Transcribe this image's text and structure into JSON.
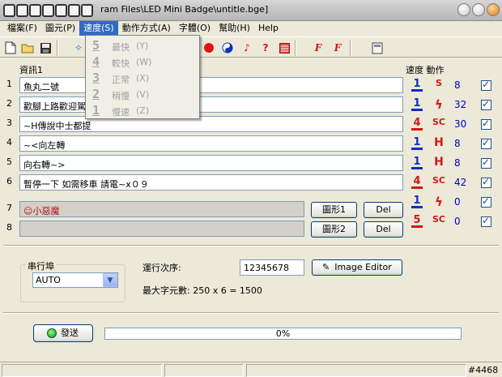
{
  "window": {
    "title_path": "ram Files\\LED Mini Badge\\untitle.bge]"
  },
  "menu": [
    {
      "label": "檔案(F)"
    },
    {
      "label": "圖元(P)"
    },
    {
      "label": "速度(S)"
    },
    {
      "label": "動作方式(A)"
    },
    {
      "label": "字體(O)"
    },
    {
      "label": "幫助(H)"
    },
    {
      "label": "Help"
    }
  ],
  "speed_menu": [
    {
      "icon": "5",
      "label": "最快",
      "key": "(Y)"
    },
    {
      "icon": "4",
      "label": "較快",
      "key": "(W)"
    },
    {
      "icon": "3",
      "label": "正常",
      "key": "(X)"
    },
    {
      "icon": "2",
      "label": "稍慢",
      "key": "(V)"
    },
    {
      "icon": "1",
      "label": "慢速",
      "key": "(Z)"
    }
  ],
  "headers": {
    "info": "資訊1",
    "speed_action": "速度 動作"
  },
  "rows": [
    {
      "num": "1",
      "text": "魚丸二號",
      "speed": "1",
      "action": "S",
      "value": "8"
    },
    {
      "num": "2",
      "text": "歡腳上路歡迎駕",
      "speed": "1",
      "action": "ϟ",
      "value": "32"
    },
    {
      "num": "3",
      "text": "~H傳說中士都提",
      "speed": "4",
      "action": "SC",
      "value": "30"
    },
    {
      "num": "4",
      "text": "~<向左轉",
      "speed": "1",
      "action": "H",
      "value": "8"
    },
    {
      "num": "5",
      "text": "向右轉~>",
      "speed": "1",
      "action": "H",
      "value": "8"
    },
    {
      "num": "6",
      "text": "暫停一下 如需移車 請電~x０９",
      "speed": "4",
      "action": "SC",
      "value": "42"
    },
    {
      "num": "7",
      "text": "小惡魔",
      "speed": "1",
      "action": "ϟ",
      "value": "0"
    },
    {
      "num": "8",
      "text": "",
      "speed": "5",
      "action": "SC",
      "value": "0"
    }
  ],
  "image_buttons": {
    "img1": "圖形1",
    "img2": "圖形2",
    "del": "Del"
  },
  "port": {
    "label": "串行埠",
    "value": "AUTO"
  },
  "order": {
    "label": "運行次序:",
    "value": "12345678",
    "image_editor": "Image Editor",
    "max_chars": "最大字元數: 250 x 6 = 1500"
  },
  "send": {
    "label": "發送",
    "progress": "0%"
  },
  "statusbar": {
    "right": "#4468"
  }
}
